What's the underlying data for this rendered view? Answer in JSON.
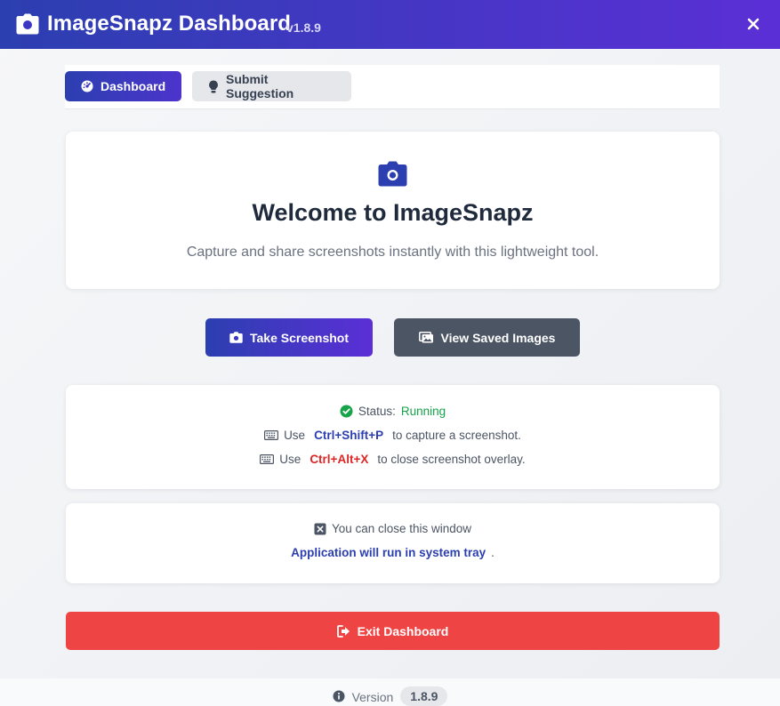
{
  "window": {
    "title": "ImageSnapz Dashboard",
    "version_tag": "v1.8.9",
    "colors": {
      "accent": "#2c3fb0",
      "accent2": "#5b2fd6",
      "danger": "#ef4444",
      "success": "#16a34a"
    }
  },
  "tabs": [
    {
      "label": "Dashboard",
      "icon": "gauge-icon",
      "active": true
    },
    {
      "label": "Submit Suggestion",
      "icon": "lightbulb-icon",
      "active": false
    }
  ],
  "welcome": {
    "icon": "camera-icon",
    "heading": "Welcome to ImageSnapz",
    "subtitle": "Capture and share screenshots instantly with this lightweight tool."
  },
  "actions": {
    "take_screenshot": "Take Screenshot",
    "view_saved": "View Saved Images"
  },
  "status": {
    "label": "Status:",
    "value": "Running",
    "capture_prefix": "Use",
    "capture_shortcut": "Ctrl+Shift+P",
    "capture_suffix": "to capture a screenshot.",
    "close_prefix": "Use",
    "close_shortcut": "Ctrl+Alt+X",
    "close_suffix": "to close screenshot overlay."
  },
  "tray": {
    "line1": "You can close this window",
    "line2": "Application will run in system tray",
    "line2_suffix": "."
  },
  "exit": {
    "label": "Exit Dashboard"
  },
  "footer": {
    "label": "Version",
    "version": "1.8.9"
  }
}
